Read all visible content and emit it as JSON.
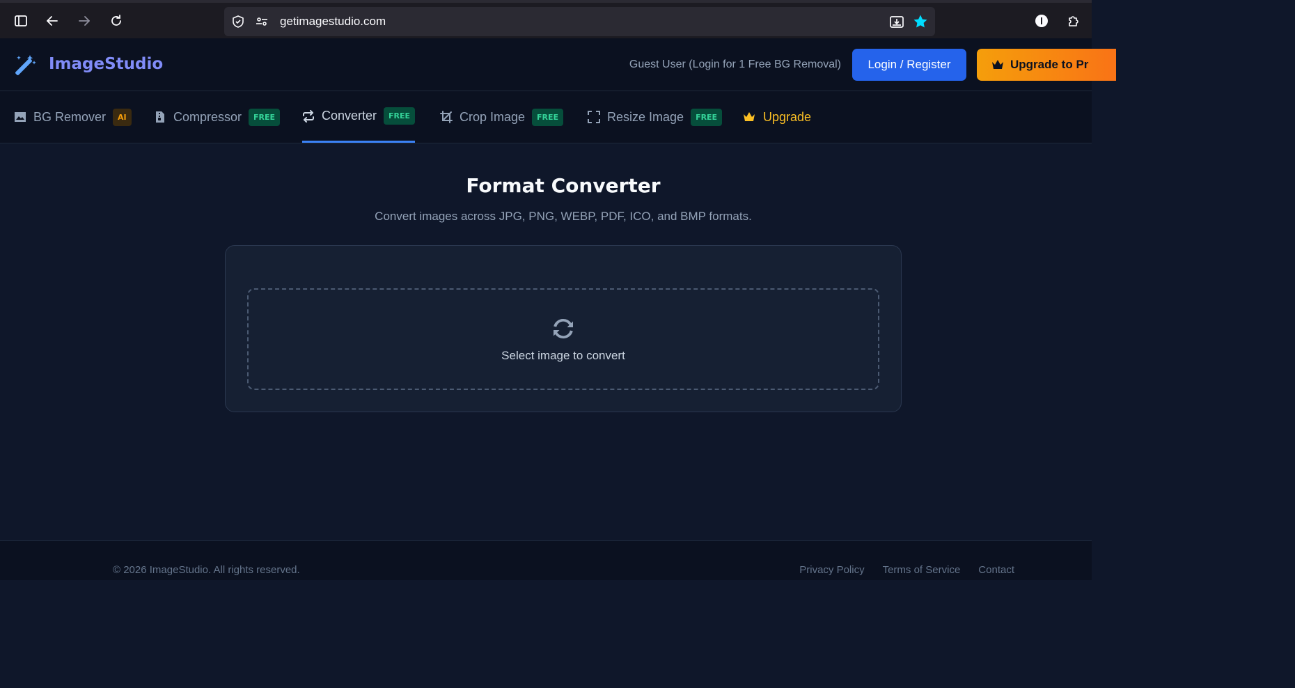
{
  "browser": {
    "url": "getimagestudio.com"
  },
  "header": {
    "brand": "ImageStudio",
    "guest_text": "Guest User (Login for 1 Free BG Removal)",
    "login_label": "Login / Register",
    "upgrade_pro_label": "Upgrade to Pr"
  },
  "nav": {
    "tabs": [
      {
        "label": "BG Remover",
        "badge": "AI",
        "icon": "image-icon"
      },
      {
        "label": "Compressor",
        "badge": "FREE",
        "icon": "file-zip-icon"
      },
      {
        "label": "Converter",
        "badge": "FREE",
        "icon": "repeat-icon",
        "active": true
      },
      {
        "label": "Crop Image",
        "badge": "FREE",
        "icon": "crop-icon"
      },
      {
        "label": "Resize Image",
        "badge": "FREE",
        "icon": "expand-icon"
      },
      {
        "label": "Upgrade",
        "icon": "crown-icon"
      }
    ]
  },
  "main": {
    "title": "Format Converter",
    "subtitle": "Convert images across JPG, PNG, WEBP, PDF, ICO, and BMP formats.",
    "dropzone_label": "Select image to convert"
  },
  "footer": {
    "copyright": "© 2026 ImageStudio. All rights reserved.",
    "links": [
      "Privacy Policy",
      "Terms of Service",
      "Contact"
    ]
  },
  "colors": {
    "accent": "#2563eb",
    "brand": "#818cf8",
    "upgrade": "#f59e0b",
    "free_badge": "#34d399"
  }
}
